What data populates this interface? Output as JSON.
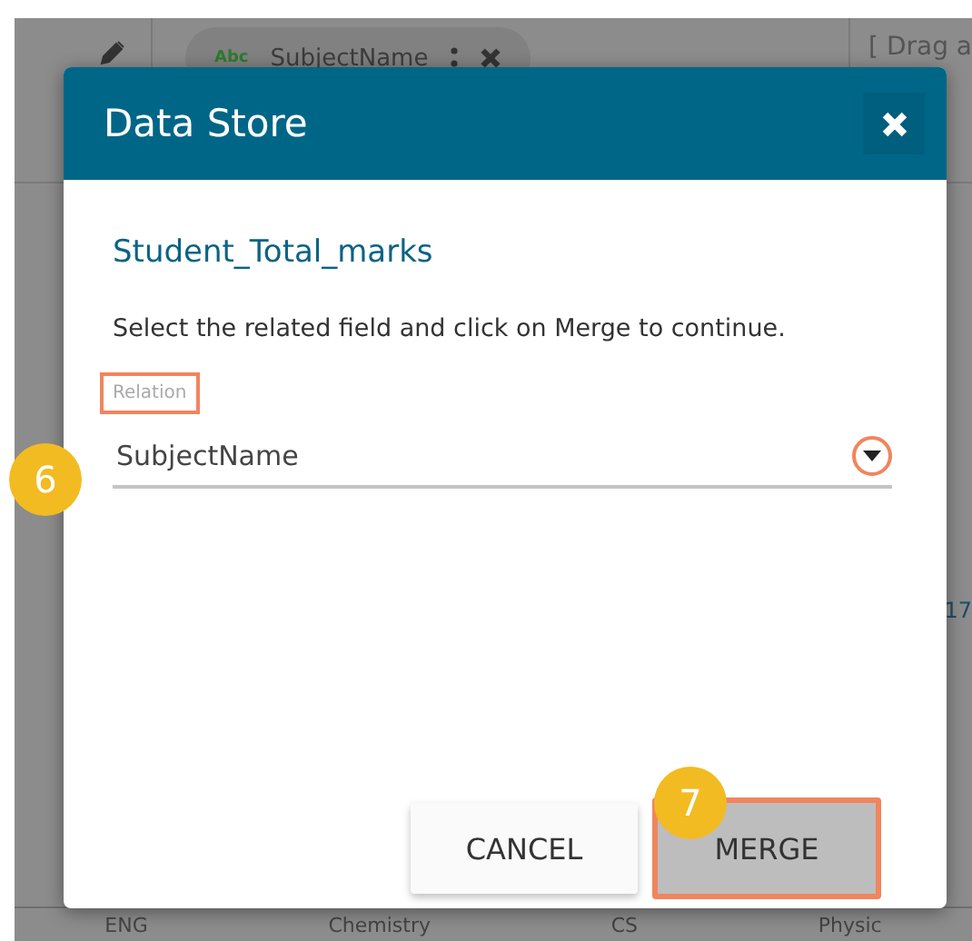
{
  "background": {
    "chip": {
      "type_tag": "Abc",
      "label": "SubjectName"
    },
    "drop_hint": "[ Drag a",
    "side_value": "17",
    "columns": [
      "ENG",
      "Chemistry",
      "CS",
      "Physic"
    ]
  },
  "dialog": {
    "title": "Data Store",
    "subtitle": "Student_Total_marks",
    "instruction": "Select the related field and click on Merge to continue.",
    "field": {
      "label": "Relation",
      "value": "SubjectName",
      "highlighted": true
    },
    "buttons": [
      {
        "kind": "cancel",
        "label": "CANCEL",
        "highlighted": false
      },
      {
        "kind": "merge",
        "label": "MERGE",
        "highlighted": true
      }
    ]
  },
  "callouts": [
    "6",
    "7"
  ]
}
